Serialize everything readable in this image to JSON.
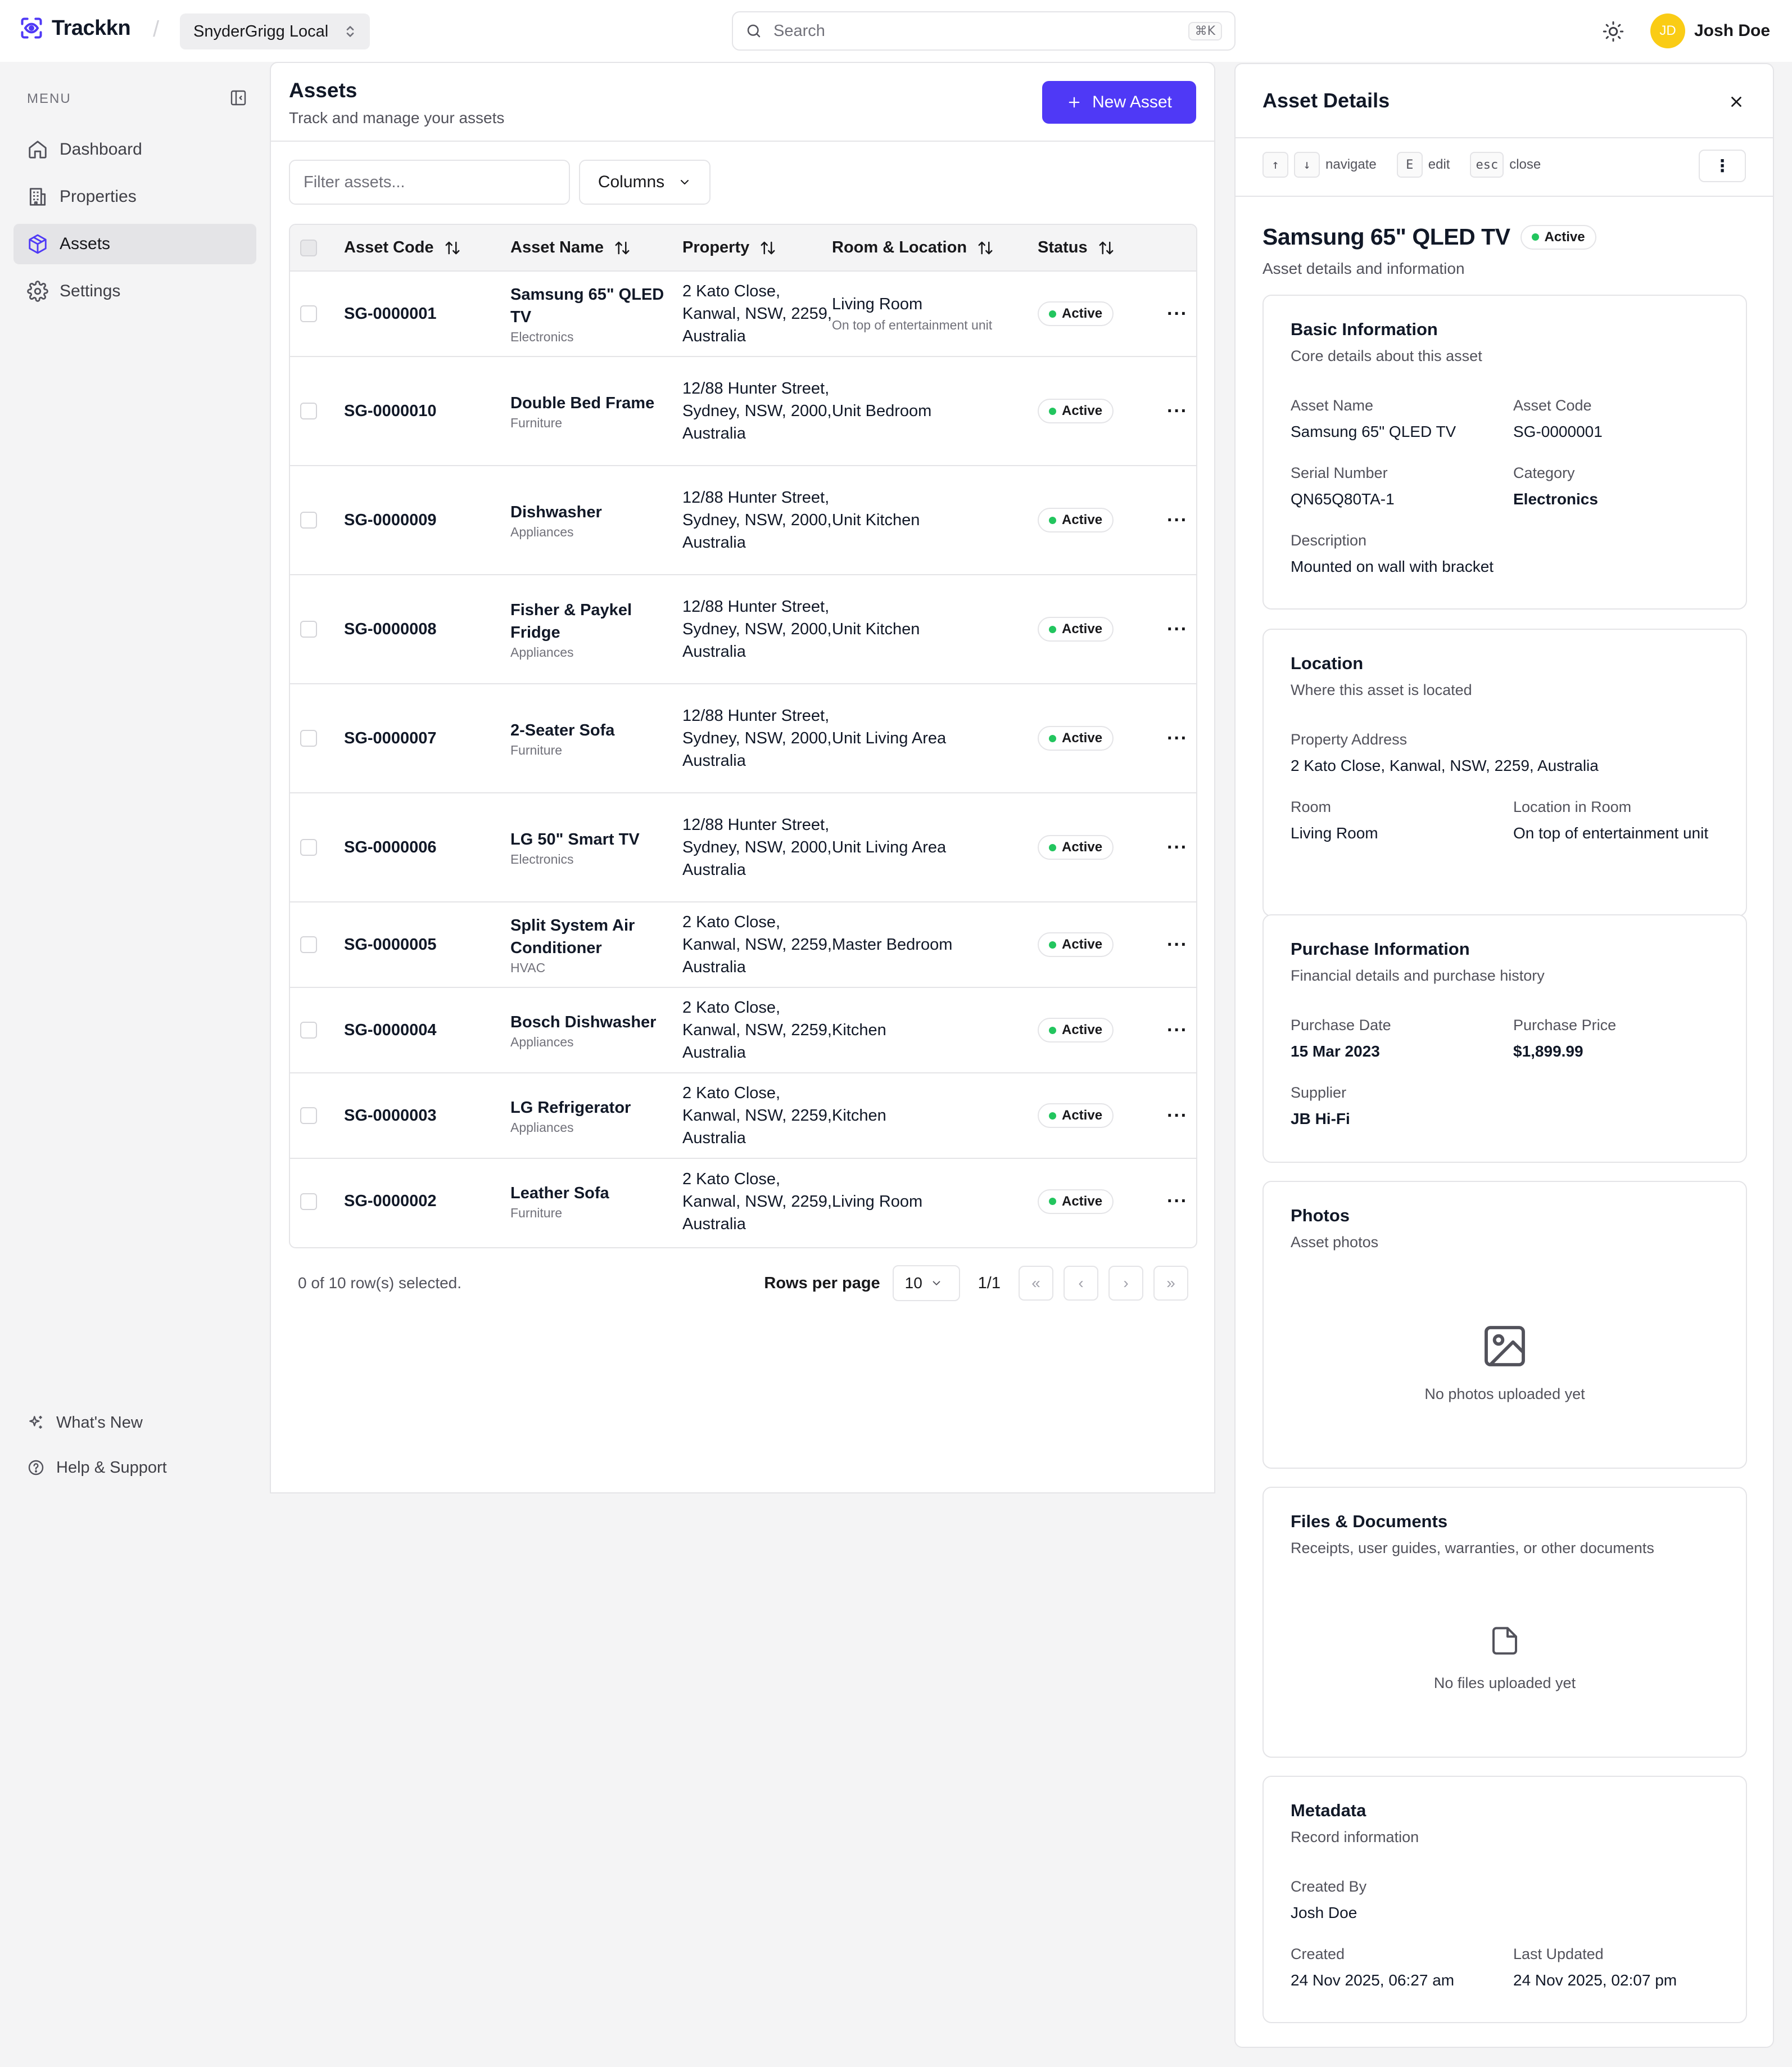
{
  "app": {
    "name": "Trackkn",
    "org": "SnyderGrigg Local"
  },
  "search": {
    "placeholder": "Search",
    "shortcut": "⌘K"
  },
  "user": {
    "initials": "JD",
    "name": "Josh Doe"
  },
  "sidebar": {
    "menu_label": "MENU",
    "items": [
      {
        "label": "Dashboard",
        "icon": "home-icon"
      },
      {
        "label": "Properties",
        "icon": "building-icon"
      },
      {
        "label": "Assets",
        "icon": "box-icon",
        "active": true
      },
      {
        "label": "Settings",
        "icon": "gear-icon"
      }
    ],
    "bottom": [
      {
        "label": "What's New",
        "icon": "sparkles-icon"
      },
      {
        "label": "Help & Support",
        "icon": "help-circle-icon"
      }
    ]
  },
  "main": {
    "title": "Assets",
    "subtitle": "Track and manage your assets",
    "new_button": "New Asset",
    "filter_placeholder": "Filter assets...",
    "columns_button": "Columns",
    "columns": [
      "Asset Code",
      "Asset Name",
      "Property",
      "Room & Location",
      "Status"
    ],
    "rows": [
      {
        "code": "SG-0000001",
        "name": "Samsung 65\" QLED TV",
        "category": "Electronics",
        "property": "2 Kato Close, Kanwal, NSW, 2259, Australia",
        "room": "Living Room",
        "location": "On top of entertainment unit",
        "status": "Active"
      },
      {
        "code": "SG-0000010",
        "name": "Double Bed Frame",
        "category": "Furniture",
        "property": "12/88 Hunter Street, Sydney, NSW, 2000, Australia",
        "room": "Unit Bedroom",
        "location": "",
        "status": "Active"
      },
      {
        "code": "SG-0000009",
        "name": "Dishwasher",
        "category": "Appliances",
        "property": "12/88 Hunter Street, Sydney, NSW, 2000, Australia",
        "room": "Unit Kitchen",
        "location": "",
        "status": "Active"
      },
      {
        "code": "SG-0000008",
        "name": "Fisher & Paykel Fridge",
        "category": "Appliances",
        "property": "12/88 Hunter Street, Sydney, NSW, 2000, Australia",
        "room": "Unit Kitchen",
        "location": "",
        "status": "Active"
      },
      {
        "code": "SG-0000007",
        "name": "2-Seater Sofa",
        "category": "Furniture",
        "property": "12/88 Hunter Street, Sydney, NSW, 2000, Australia",
        "room": "Unit Living Area",
        "location": "",
        "status": "Active"
      },
      {
        "code": "SG-0000006",
        "name": "LG 50\" Smart TV",
        "category": "Electronics",
        "property": "12/88 Hunter Street, Sydney, NSW, 2000, Australia",
        "room": "Unit Living Area",
        "location": "",
        "status": "Active"
      },
      {
        "code": "SG-0000005",
        "name": "Split System Air Conditioner",
        "category": "HVAC",
        "property": "2 Kato Close, Kanwal, NSW, 2259, Australia",
        "room": "Master Bedroom",
        "location": "",
        "status": "Active"
      },
      {
        "code": "SG-0000004",
        "name": "Bosch Dishwasher",
        "category": "Appliances",
        "property": "2 Kato Close, Kanwal, NSW, 2259, Australia",
        "room": "Kitchen",
        "location": "",
        "status": "Active"
      },
      {
        "code": "SG-0000003",
        "name": "LG Refrigerator",
        "category": "Appliances",
        "property": "2 Kato Close, Kanwal, NSW, 2259, Australia",
        "room": "Kitchen",
        "location": "",
        "status": "Active"
      },
      {
        "code": "SG-0000002",
        "name": "Leather Sofa",
        "category": "Furniture",
        "property": "2 Kato Close, Kanwal, NSW, 2259, Australia",
        "room": "Living Room",
        "location": "",
        "status": "Active"
      }
    ],
    "footer": {
      "selection": "0 of 10 row(s) selected.",
      "rows_per_page_label": "Rows per page",
      "rows_per_page": "10",
      "page": "1/1",
      "first": "«",
      "prev": "‹",
      "next": "›",
      "last": "»"
    }
  },
  "details": {
    "title": "Asset Details",
    "close": "×",
    "shortcuts": {
      "up": "↑",
      "down": "↓",
      "navigate": "navigate",
      "edit_key": "E",
      "edit": "edit",
      "esc_key": "esc",
      "close": "close"
    },
    "more": "⋮",
    "asset_title": "Samsung 65\" QLED TV",
    "status": "Active",
    "subtitle": "Asset details and information",
    "basic": {
      "title": "Basic Information",
      "subtitle": "Core details about this asset",
      "name_label": "Asset Name",
      "name": "Samsung 65\" QLED TV",
      "code_label": "Asset Code",
      "code": "SG-0000001",
      "serial_label": "Serial Number",
      "serial": "QN65Q80TA-1",
      "category_label": "Category",
      "category": "Electronics",
      "desc_label": "Description",
      "desc": "Mounted on wall with bracket"
    },
    "location": {
      "title": "Location",
      "subtitle": "Where this asset is located",
      "address_label": "Property Address",
      "address": "2 Kato Close, Kanwal, NSW, 2259, Australia",
      "room_label": "Room",
      "room": "Living Room",
      "loc_label": "Location in Room",
      "loc": "On top of entertainment unit"
    },
    "purchase": {
      "title": "Purchase Information",
      "subtitle": "Financial details and purchase history",
      "date_label": "Purchase Date",
      "date": "15 Mar 2023",
      "price_label": "Purchase Price",
      "price": "$1,899.99",
      "supplier_label": "Supplier",
      "supplier": "JB Hi-Fi"
    },
    "photos": {
      "title": "Photos",
      "subtitle": "Asset photos",
      "empty": "No photos uploaded yet"
    },
    "files": {
      "title": "Files & Documents",
      "subtitle": "Receipts, user guides, warranties, or other documents",
      "empty": "No files uploaded yet"
    },
    "metadata": {
      "title": "Metadata",
      "subtitle": "Record information",
      "created_by_label": "Created By",
      "created_by": "Josh Doe",
      "created_label": "Created",
      "created": "24 Nov 2025, 06:27 am",
      "updated_label": "Last Updated",
      "updated": "24 Nov 2025, 02:07 pm"
    }
  },
  "colors": {
    "accent": "#4f39f6",
    "active_dot": "#22c55e",
    "avatar": "#facc15"
  }
}
